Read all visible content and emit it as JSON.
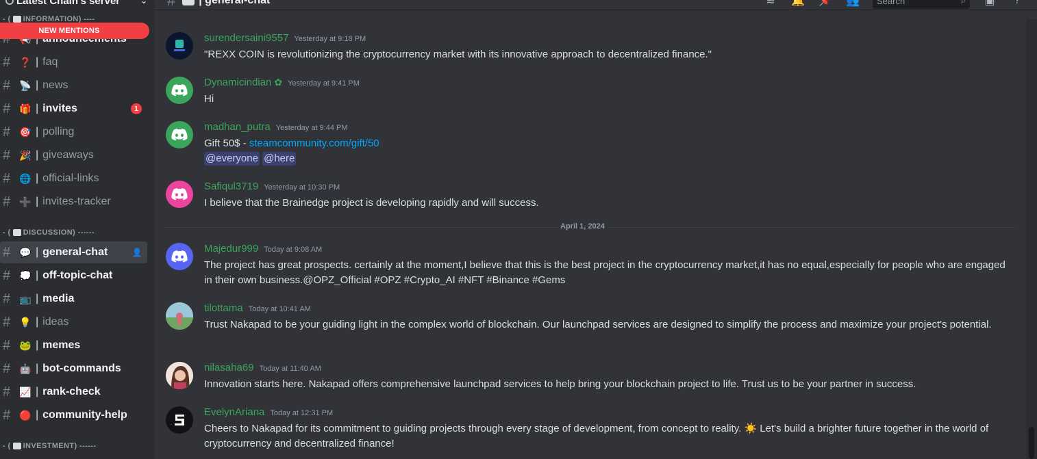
{
  "server": {
    "name": "Latest Chain's server"
  },
  "new_mentions_label": "NEW MENTIONS",
  "categories": {
    "information": "INFORMATION) ----",
    "discussion": "DISCUSSION) ------",
    "investment": "INVESTMENT) ------"
  },
  "category_prefix": "- (",
  "channels": [
    {
      "name": "announcements",
      "emoji": "📢",
      "unread": true
    },
    {
      "name": "faq",
      "emoji": "❓",
      "unread": false
    },
    {
      "name": "news",
      "emoji": "📡",
      "unread": false
    },
    {
      "name": "invites",
      "emoji": "🎁",
      "unread": true,
      "badge": "1"
    },
    {
      "name": "polling",
      "emoji": "🎯",
      "unread": false
    },
    {
      "name": "giveaways",
      "emoji": "🎉",
      "unread": false
    },
    {
      "name": "official-links",
      "emoji": "🌐",
      "unread": false
    },
    {
      "name": "invites-tracker",
      "emoji": "➕",
      "unread": false
    },
    {
      "name": "general-chat",
      "emoji": "💬",
      "unread": false,
      "active": true
    },
    {
      "name": "off-topic-chat",
      "emoji": "💭",
      "unread": true
    },
    {
      "name": "media",
      "emoji": "📺",
      "unread": true
    },
    {
      "name": "ideas",
      "emoji": "💡",
      "unread": false
    },
    {
      "name": "memes",
      "emoji": "🐸",
      "unread": true
    },
    {
      "name": "bot-commands",
      "emoji": "🤖",
      "unread": true
    },
    {
      "name": "rank-check",
      "emoji": "📈",
      "unread": true
    },
    {
      "name": "community-help",
      "emoji": "🔴",
      "unread": true
    }
  ],
  "header": {
    "channel_name": "general-chat",
    "search_placeholder": "Search"
  },
  "messages": [
    {
      "user": "surendersaini9557",
      "time": "Yesterday at 9:18 PM",
      "avatar": "coin",
      "text": "\"REXX COIN is revolutionizing the cryptocurrency market with its innovative approach to decentralized finance.\""
    },
    {
      "user": "Dynamicindian",
      "time": "Yesterday at 9:41 PM",
      "avatar": "discord-green",
      "verified": true,
      "text": "Hi"
    },
    {
      "user": "madhan_putra",
      "time": "Yesterday at 9:44 PM",
      "avatar": "discord-green",
      "text": "Gift 50$ - ",
      "link": "steamcommunity.com/gift/50",
      "mentions": [
        "@everyone",
        "@here"
      ]
    },
    {
      "user": "Safiqul3719",
      "time": "Yesterday at 10:30 PM",
      "avatar": "discord-pink",
      "text": "I believe that the Brainedge project is developing rapidly and will success."
    },
    {
      "user": "Majedur999",
      "time": "Today at 9:08 AM",
      "avatar": "discord-blurple",
      "text": "The project has great prospects. certainly at the moment,I believe that this is the best project in the cryptocurrency market,it has no equal,especially for people who are engaged in their own business.@OPZ_Official #OPZ #Crypto_AI #NFT #Binance #Gems"
    },
    {
      "user": "tilottama",
      "time": "Today at 10:41 AM",
      "avatar": "photo-outdoor",
      "text": "Trust Nakapad to be your guiding light in the complex world of blockchain. Our launchpad services are designed to simplify the process and maximize your project's potential."
    },
    {
      "user": "nilasaha69",
      "time": "Today at 11:40 AM",
      "avatar": "photo-person",
      "text": "Innovation starts here. Nakapad offers comprehensive launchpad services to help bring your blockchain project to life. Trust us to be your partner in success."
    },
    {
      "user": "EvelynAriana",
      "time": "Today at 12:31 PM",
      "avatar": "s-logo",
      "text": "Cheers to Nakapad for its commitment to guiding projects through every stage of development, from concept to reality. ",
      "emoji": "☀️",
      "text2": " Let's build a brighter future together in the world of cryptocurrency and decentralized finance!"
    }
  ],
  "date_divider": "April 1, 2024",
  "colors": {
    "username": "#3ba55c",
    "link": "#00a8fc",
    "mention_bg": "#3c4270",
    "badge": "#f23f43",
    "sidebar_bg": "#2b2d31",
    "chat_bg": "#313338"
  }
}
